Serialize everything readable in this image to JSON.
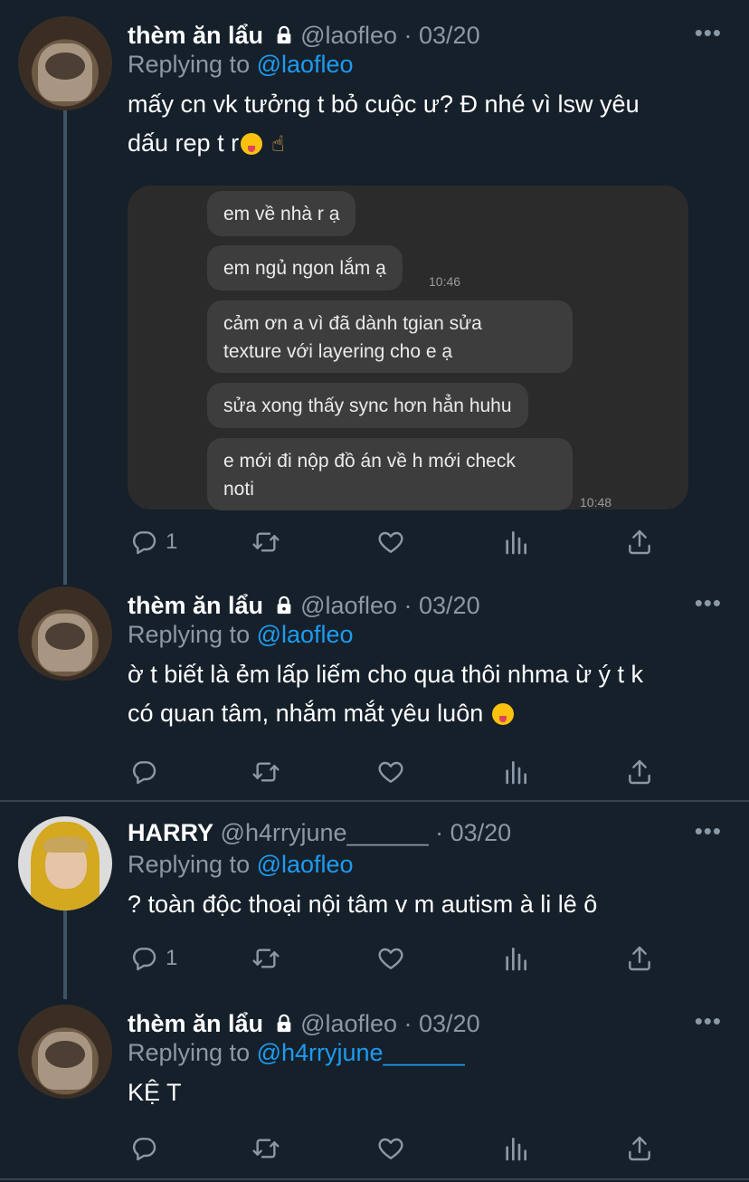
{
  "tweets": [
    {
      "name": "thèm ăn lẩu",
      "handle": "@laofleo · 03/20",
      "replying_label": "Replying to ",
      "replying_to": "@laofleo",
      "text_line1": "mấy cn vk tưởng t bỏ cuộc ư? Đ nhé vì lsw yêu",
      "text_line2": "dấu rep t r",
      "reply_count": "1",
      "chat": {
        "bubbles": [
          "em về nhà r ạ",
          "em ngủ ngon lắm ạ",
          "cảm ơn a vì đã dành tgian sửa",
          "texture với layering cho e ạ",
          "sửa xong thấy sync hơn hẳn huhu",
          "e mới đi nộp đồ án về h mới check",
          "noti"
        ],
        "time1": "10:46",
        "time2": "10:48"
      }
    },
    {
      "name": "thèm ăn lẩu",
      "handle": "@laofleo · 03/20",
      "replying_label": "Replying to ",
      "replying_to": "@laofleo",
      "text_line1": "ờ t biết là ẻm lấp liếm cho qua thôi nhma ừ ý t k",
      "text_line2": "có quan tâm, nhắm mắt yêu luôn",
      "reply_count": ""
    },
    {
      "name": "HARRY",
      "handle": "@h4rryjune______ · 03/20",
      "replying_label": "Replying to ",
      "replying_to": "@laofleo",
      "text_line1": "? toàn độc thoại nội tâm v m autism à li lê ô",
      "reply_count": "1"
    },
    {
      "name": "thèm ăn lẩu",
      "handle": "@laofleo · 03/20",
      "replying_label": "Replying to ",
      "replying_to": "@h4rryjune______",
      "text_line1": "KỆ T",
      "reply_count": ""
    }
  ],
  "more_glyph": "•••",
  "colors": {
    "background": "#15202b",
    "link": "#1d9bf0",
    "muted": "#8b98a5",
    "divider": "#38444d"
  },
  "icons": [
    "lock-icon",
    "more-icon",
    "reply-icon",
    "retweet-icon",
    "like-icon",
    "analytics-icon",
    "share-icon"
  ]
}
